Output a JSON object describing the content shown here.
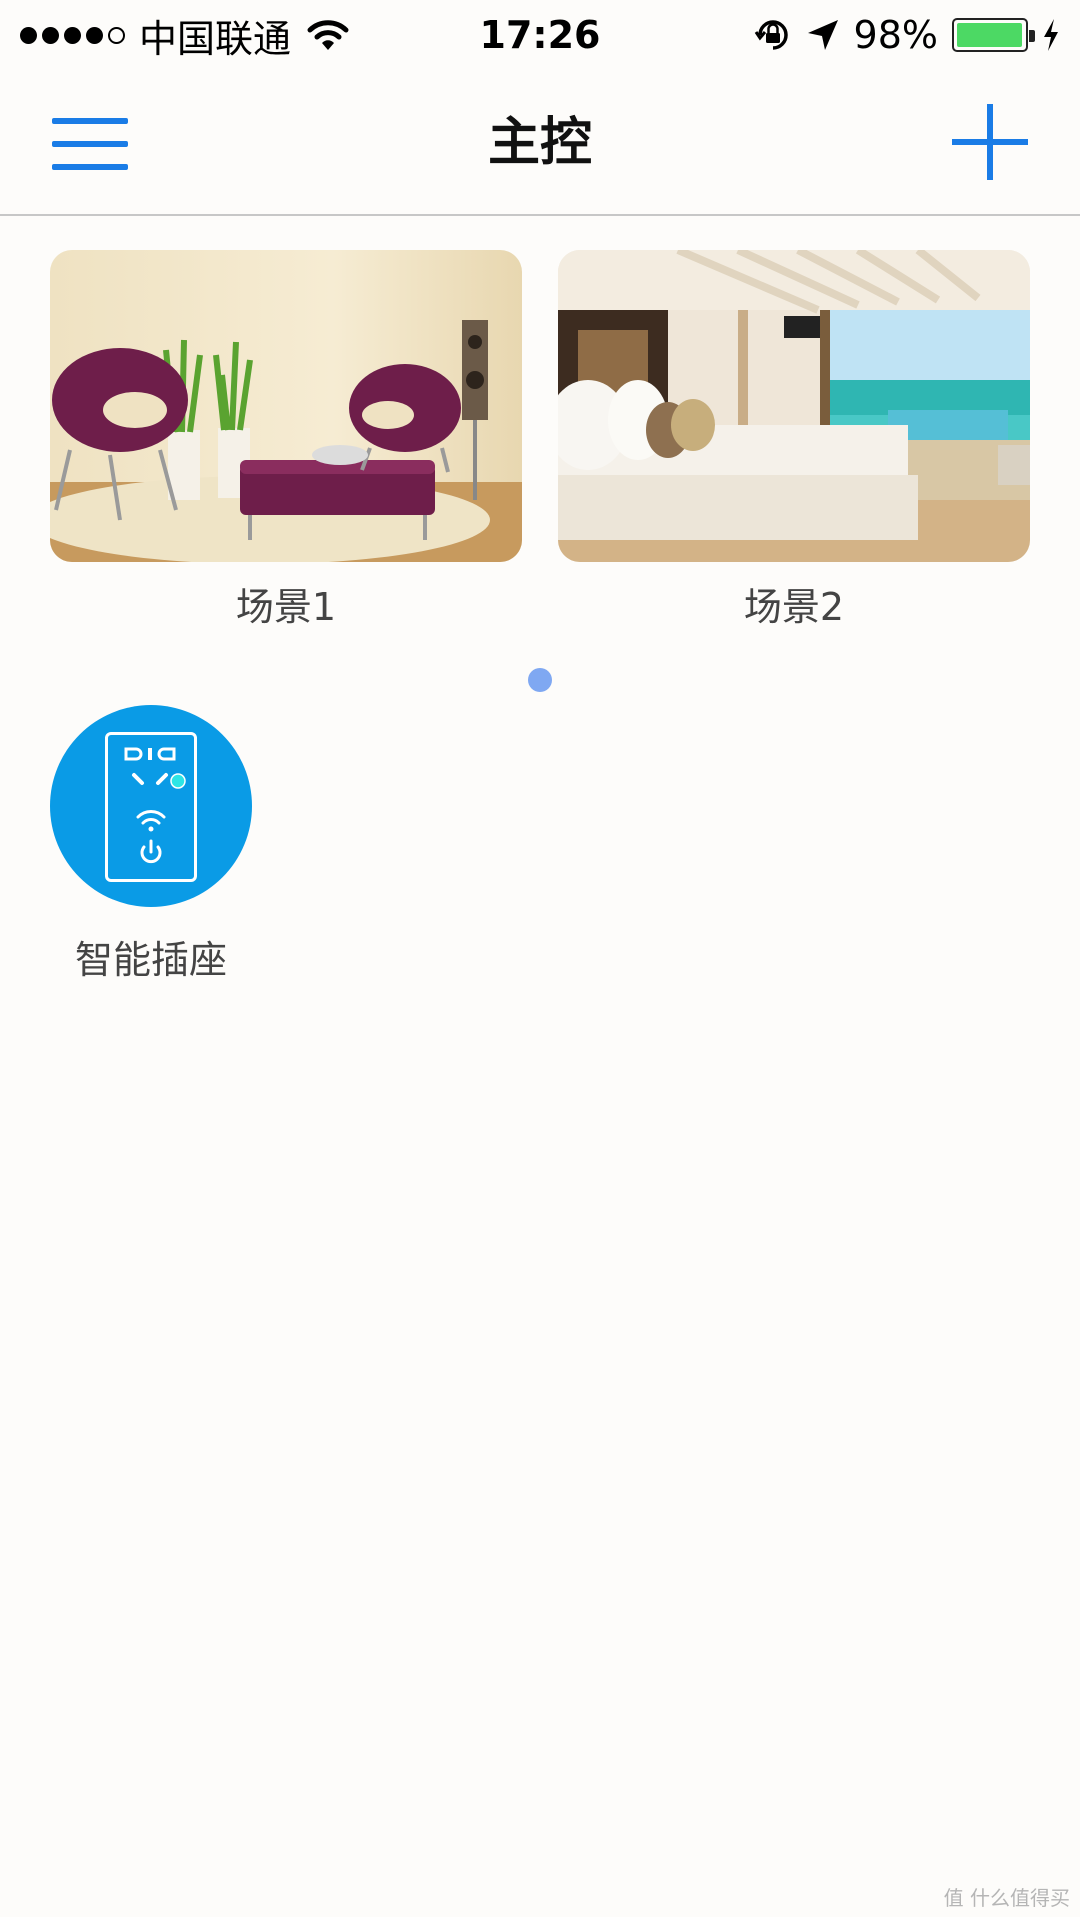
{
  "status_bar": {
    "carrier": "中国联通",
    "time": "17:26",
    "battery_percent": "98%",
    "battery_level": 0.98,
    "signal_bars_filled": 4,
    "signal_bars_total": 5,
    "icons": [
      "wifi-icon",
      "orientation-lock-icon",
      "location-arrow-icon",
      "battery-icon",
      "charging-bolt-icon"
    ]
  },
  "navbar": {
    "title": "主控",
    "left_icon": "menu-icon",
    "right_icon": "plus-icon"
  },
  "scenes": [
    {
      "label": "场景1",
      "image": "living-room-photo"
    },
    {
      "label": "场景2",
      "image": "bedroom-seaview-photo"
    }
  ],
  "pager": {
    "pages": 1,
    "current": 1
  },
  "devices": [
    {
      "label": "智能插座",
      "icon": "smart-plug-icon"
    }
  ],
  "watermark": "值 什么值得买",
  "colors": {
    "accent": "#1a7ce6",
    "device_icon_bg": "#0a9be6",
    "pager_dot": "#7fa8f2",
    "battery_fill": "#4cd964",
    "background": "#fdfcfa"
  }
}
